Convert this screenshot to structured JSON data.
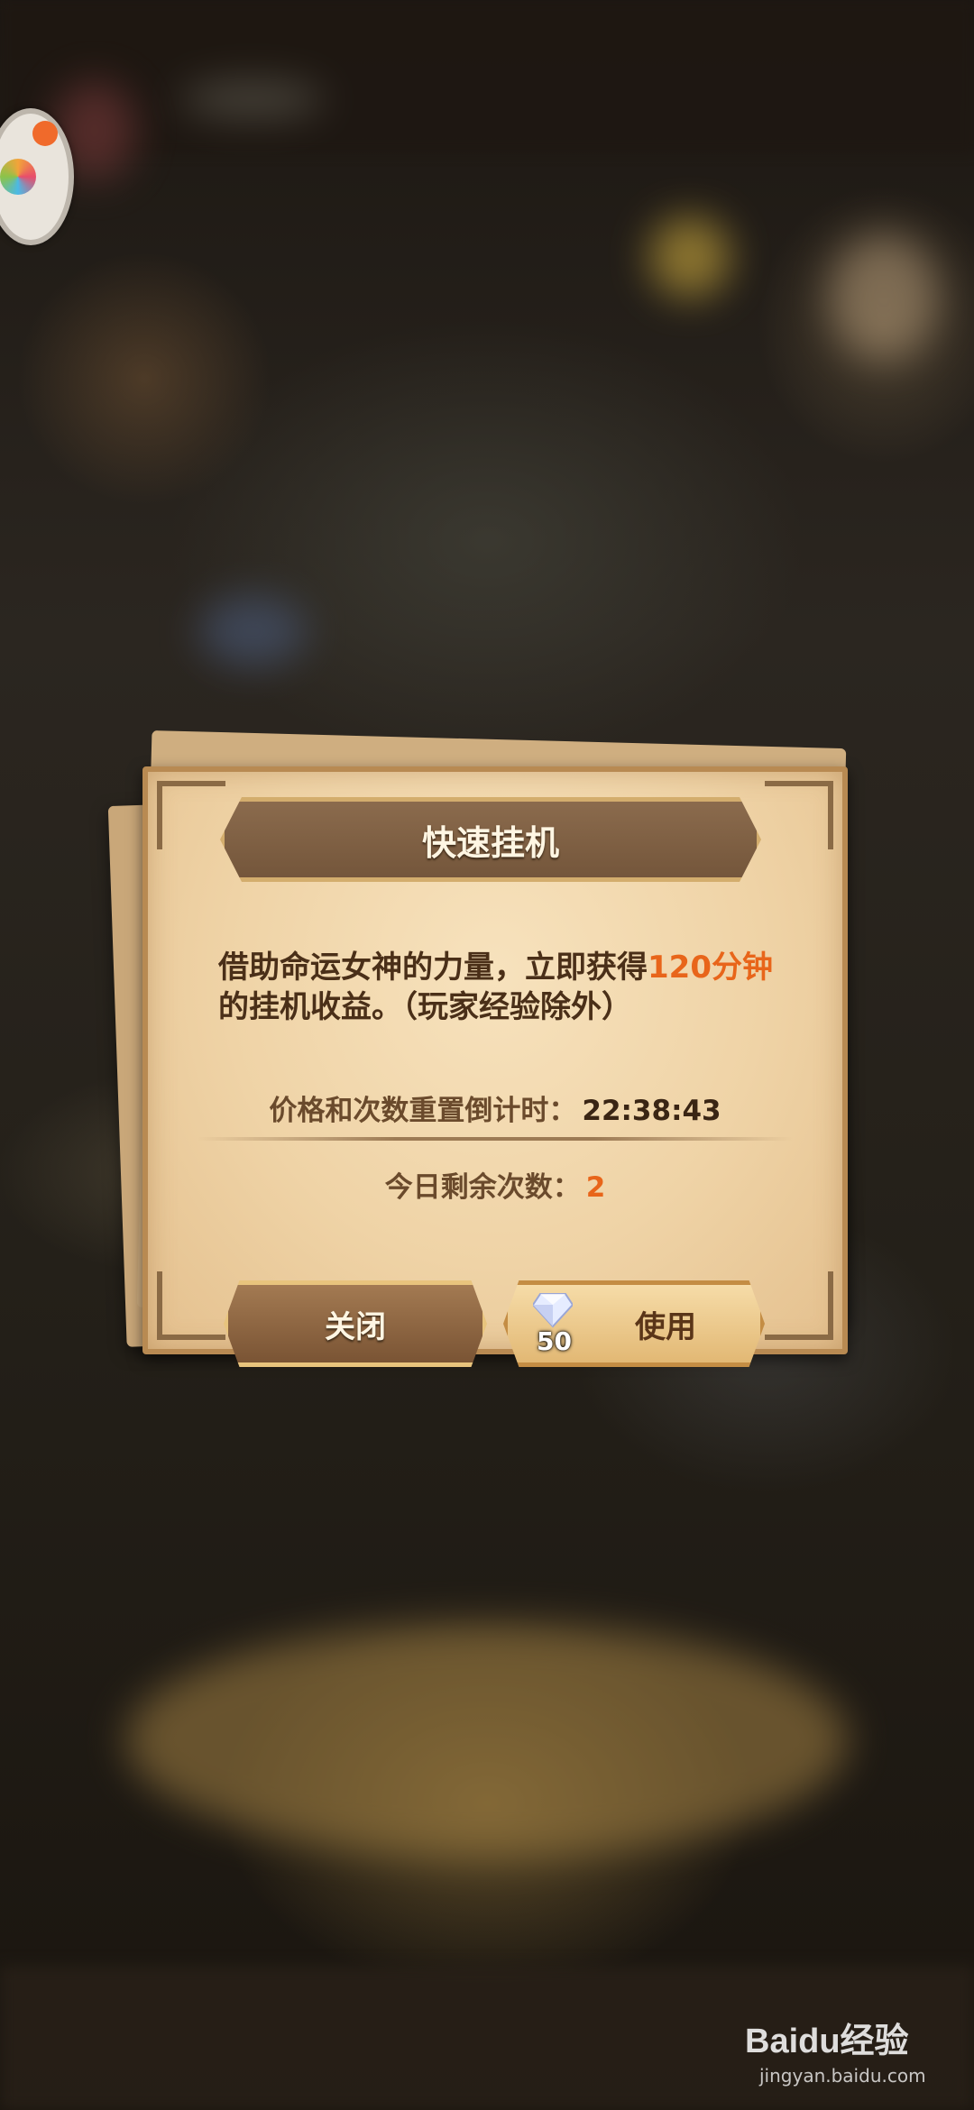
{
  "dialog": {
    "title": "快速挂机",
    "description_part1": "借助命运女神的力量，立即获得",
    "description_highlight": "120分钟",
    "description_part2": "的挂机收益。（玩家经验除外）",
    "countdown_label": "价格和次数重置倒计时：",
    "countdown_time": "22:38:43",
    "remaining_label": "今日剩余次数：",
    "remaining_count": "2",
    "close_label": "关闭",
    "use_label": "使用",
    "cost_amount": "50",
    "cost_icon": "diamond-icon"
  },
  "watermark": {
    "brand": "Baidu经验",
    "url": "jingyan.baidu.com"
  },
  "colors": {
    "highlight": "#e8651a",
    "paper": "#f2d9ae",
    "banner": "#7a5a3e"
  }
}
